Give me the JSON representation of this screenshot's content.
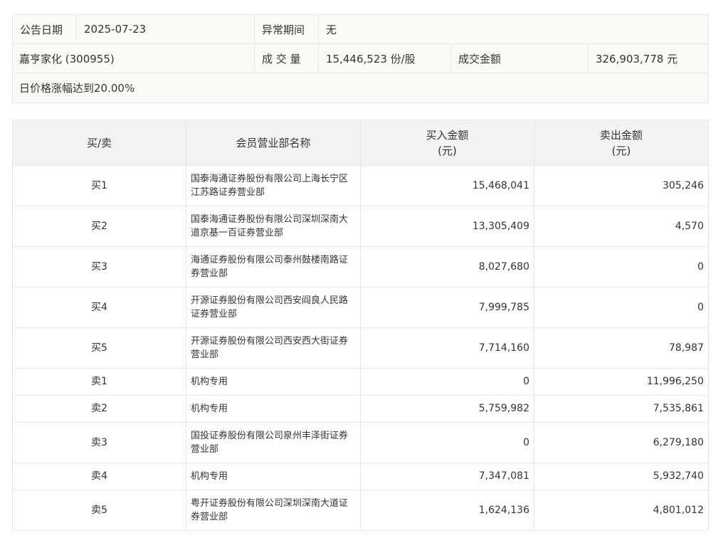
{
  "summary": {
    "date_label": "公告日期",
    "date_value": "2025-07-23",
    "abnormal_label": "异常期间",
    "abnormal_value": "无",
    "stock": "嘉亨家化 (300955)",
    "volume_label": "成 交 量",
    "volume_value": "15,446,523 份/股",
    "amount_label": "成交金额",
    "amount_value": "326,903,778 元",
    "reason": "日价格涨幅达到20.00%"
  },
  "table": {
    "headers": {
      "side": "买/卖",
      "name": "会员营业部名称",
      "buy_line1": "买入金额",
      "buy_line2": "(元)",
      "sell_line1": "卖出金额",
      "sell_line2": "(元)"
    },
    "rows": [
      {
        "side": "买1",
        "name": "国泰海通证券股份有限公司上海长宁区江苏路证券营业部",
        "buy": "15,468,041",
        "sell": "305,246"
      },
      {
        "side": "买2",
        "name": "国泰海通证券股份有限公司深圳深南大道京基一百证券营业部",
        "buy": "13,305,409",
        "sell": "4,570"
      },
      {
        "side": "买3",
        "name": "海通证券股份有限公司泰州鼓楼南路证券营业部",
        "buy": "8,027,680",
        "sell": "0"
      },
      {
        "side": "买4",
        "name": "开源证券股份有限公司西安阎良人民路证券营业部",
        "buy": "7,999,785",
        "sell": "0"
      },
      {
        "side": "买5",
        "name": "开源证券股份有限公司西安西大街证券营业部",
        "buy": "7,714,160",
        "sell": "78,987"
      },
      {
        "side": "卖1",
        "name": "机构专用",
        "buy": "0",
        "sell": "11,996,250"
      },
      {
        "side": "卖2",
        "name": "机构专用",
        "buy": "5,759,982",
        "sell": "7,535,861"
      },
      {
        "side": "卖3",
        "name": "国投证券股份有限公司泉州丰泽街证券营业部",
        "buy": "0",
        "sell": "6,279,180"
      },
      {
        "side": "卖4",
        "name": "机构专用",
        "buy": "7,347,081",
        "sell": "5,932,740"
      },
      {
        "side": "卖5",
        "name": "粤开证券股份有限公司深圳深南大道证券营业部",
        "buy": "1,624,136",
        "sell": "4,801,012"
      }
    ]
  }
}
